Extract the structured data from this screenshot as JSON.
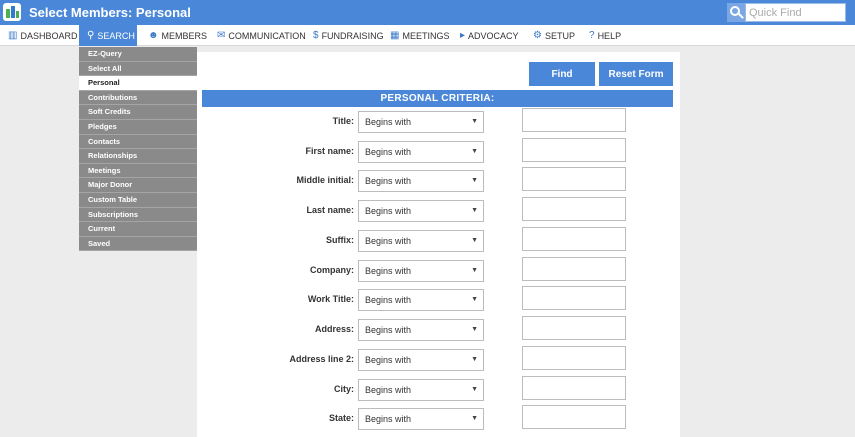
{
  "titlebar": {
    "title": "Select Members: Personal",
    "quick_find_placeholder": "Quick Find"
  },
  "nav": [
    {
      "label": "DASHBOARD",
      "icon": "dashboard-icon",
      "active": false
    },
    {
      "label": "SEARCH",
      "icon": "search-icon",
      "active": true
    },
    {
      "label": "MEMBERS",
      "icon": "members-icon",
      "active": false
    },
    {
      "label": "COMMUNICATION",
      "icon": "envelope-icon",
      "active": false
    },
    {
      "label": "FUNDRAISING",
      "icon": "dollar-icon",
      "active": false
    },
    {
      "label": "MEETINGS",
      "icon": "calendar-icon",
      "active": false
    },
    {
      "label": "ADVOCACY",
      "icon": "megaphone-icon",
      "active": false
    },
    {
      "label": "SETUP",
      "icon": "gear-icon",
      "active": false
    },
    {
      "label": "HELP",
      "icon": "help-icon",
      "active": false
    }
  ],
  "sidebar": [
    {
      "label": "EZ-Query",
      "active": false
    },
    {
      "label": "Select All",
      "active": false
    },
    {
      "label": "Personal",
      "active": true
    },
    {
      "label": "Contributions",
      "active": false
    },
    {
      "label": "Soft Credits",
      "active": false
    },
    {
      "label": "Pledges",
      "active": false
    },
    {
      "label": "Contacts",
      "active": false
    },
    {
      "label": "Relationships",
      "active": false
    },
    {
      "label": "Meetings",
      "active": false
    },
    {
      "label": "Major Donor",
      "active": false
    },
    {
      "label": "Custom Table",
      "active": false
    },
    {
      "label": "Subscriptions",
      "active": false
    },
    {
      "label": "Current",
      "active": false
    },
    {
      "label": "Saved",
      "active": false
    }
  ],
  "buttons": {
    "find": "Find",
    "reset": "Reset Form"
  },
  "section_header": "PERSONAL CRITERIA:",
  "criteria": [
    {
      "label": "Title:",
      "operator": "Begins with",
      "value": ""
    },
    {
      "label": "First name:",
      "operator": "Begins with",
      "value": ""
    },
    {
      "label": "Middle initial:",
      "operator": "Begins with",
      "value": ""
    },
    {
      "label": "Last name:",
      "operator": "Begins with",
      "value": ""
    },
    {
      "label": "Suffix:",
      "operator": "Begins with",
      "value": ""
    },
    {
      "label": "Company:",
      "operator": "Begins with",
      "value": ""
    },
    {
      "label": "Work Title:",
      "operator": "Begins with",
      "value": ""
    },
    {
      "label": "Address:",
      "operator": "Begins with",
      "value": ""
    },
    {
      "label": "Address line 2:",
      "operator": "Begins with",
      "value": ""
    },
    {
      "label": "City:",
      "operator": "Begins with",
      "value": ""
    },
    {
      "label": "State:",
      "operator": "Begins with",
      "value": ""
    }
  ],
  "colors": {
    "accent": "#4a87d8",
    "sidebar": "#8a8a8a",
    "background": "#ececec"
  }
}
